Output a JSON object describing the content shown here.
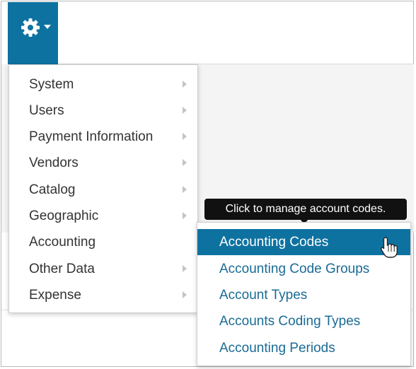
{
  "toolbar": {
    "settings_icon": "gear-icon",
    "caret_icon": "caret-down-icon",
    "accent_color": "#0e72a1"
  },
  "menu": {
    "items": [
      {
        "label": "System",
        "has_submenu": true
      },
      {
        "label": "Users",
        "has_submenu": true
      },
      {
        "label": "Payment Information",
        "has_submenu": true
      },
      {
        "label": "Vendors",
        "has_submenu": true
      },
      {
        "label": "Catalog",
        "has_submenu": true
      },
      {
        "label": "Geographic",
        "has_submenu": true
      },
      {
        "label": "Accounting",
        "has_submenu": false
      },
      {
        "label": "Other Data",
        "has_submenu": true
      },
      {
        "label": "Expense",
        "has_submenu": true
      }
    ]
  },
  "tooltip": {
    "text": "Click to manage account codes."
  },
  "submenu": {
    "items": [
      {
        "label": "Accounting Codes",
        "active": true
      },
      {
        "label": "Accounting Code Groups",
        "active": false
      },
      {
        "label": "Account Types",
        "active": false
      },
      {
        "label": "Accounts Coding Types",
        "active": false
      },
      {
        "label": "Accounting Periods",
        "active": false
      }
    ]
  },
  "cursor": {
    "icon": "hand-pointer-icon"
  }
}
